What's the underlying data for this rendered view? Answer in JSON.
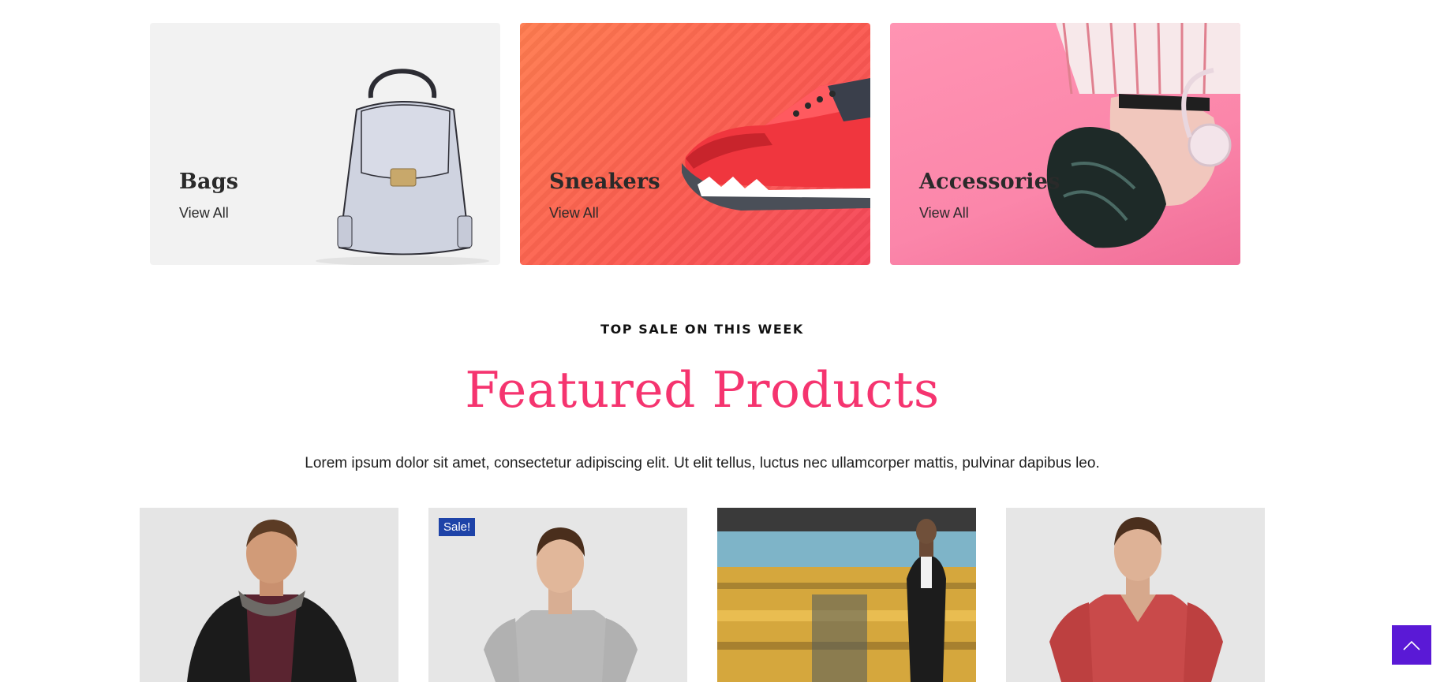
{
  "categories": [
    {
      "title": "Bags",
      "link": "View All",
      "image": "backpack-image"
    },
    {
      "title": "Sneakers",
      "link": "View All",
      "image": "sneaker-image"
    },
    {
      "title": "Accessories",
      "link": "View All",
      "image": "headphones-model-image"
    }
  ],
  "featured": {
    "eyebrow": "TOP SALE ON THIS WEEK",
    "title": "Featured Products",
    "description": "Lorem ipsum dolor sit amet, consectetur adipiscing elit. Ut elit tellus, luctus nec ullamcorper mattis, pulvinar dapibus leo."
  },
  "products": [
    {
      "image": "man-black-hoodie-image"
    },
    {
      "image": "man-grey-tshirt-image",
      "badge": "Sale!"
    },
    {
      "image": "man-suit-street-image"
    },
    {
      "image": "man-red-tshirt-image"
    }
  ],
  "colors": {
    "accent_pink": "#f5346f",
    "sale_badge": "#1e43a8",
    "scroll_top": "#5a19d6"
  },
  "scroll_top": {
    "icon": "chevron-up-icon"
  }
}
